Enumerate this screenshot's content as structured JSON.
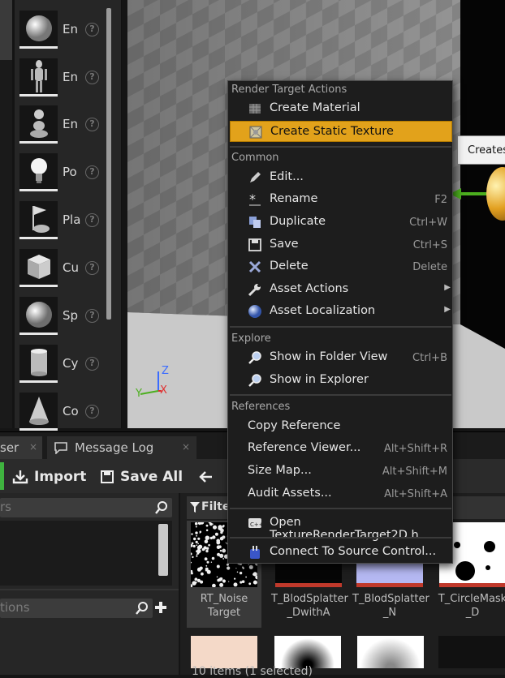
{
  "place_panel": {
    "items": [
      {
        "label": "En",
        "icon": "sphere-actor-icon"
      },
      {
        "label": "En",
        "icon": "mannequin-icon"
      },
      {
        "label": "En",
        "icon": "pawn-icon"
      },
      {
        "label": "Po",
        "icon": "point-light-icon"
      },
      {
        "label": "Pla",
        "icon": "player-start-icon"
      },
      {
        "label": "Cu",
        "icon": "cube-icon"
      },
      {
        "label": "Sp",
        "icon": "sphere-icon"
      },
      {
        "label": "Cy",
        "icon": "cylinder-icon"
      },
      {
        "label": "Co",
        "icon": "cone-icon"
      }
    ],
    "help": "?"
  },
  "viewport": {
    "tooltip": "Creates",
    "axis": {
      "z": "Z",
      "y": "Y",
      "x": "X"
    }
  },
  "context_menu": {
    "sections": {
      "render_target": "Render Target Actions",
      "common": "Common",
      "explore": "Explore",
      "references": "References"
    },
    "render_target_items": [
      {
        "label": "Create Material",
        "icon": "material-icon",
        "shortcut": ""
      },
      {
        "label": "Create Static Texture",
        "icon": "texture-icon",
        "shortcut": ""
      }
    ],
    "common_items": [
      {
        "label": "Edit...",
        "icon": "edit-icon",
        "shortcut": ""
      },
      {
        "label": "Rename",
        "icon": "rename-icon",
        "shortcut": "F2"
      },
      {
        "label": "Duplicate",
        "icon": "duplicate-icon",
        "shortcut": "Ctrl+W"
      },
      {
        "label": "Save",
        "icon": "save-icon",
        "shortcut": "Ctrl+S"
      },
      {
        "label": "Delete",
        "icon": "delete-icon",
        "shortcut": "Delete"
      },
      {
        "label": "Asset Actions",
        "icon": "wrench-icon",
        "shortcut": ""
      },
      {
        "label": "Asset Localization",
        "icon": "globe-icon",
        "shortcut": ""
      }
    ],
    "explore_items": [
      {
        "label": "Show in Folder View",
        "icon": "folder-search-icon",
        "shortcut": "Ctrl+B"
      },
      {
        "label": "Show in Explorer",
        "icon": "explorer-search-icon",
        "shortcut": ""
      }
    ],
    "reference_items": [
      {
        "label": "Copy Reference",
        "shortcut": ""
      },
      {
        "label": "Reference Viewer...",
        "shortcut": "Alt+Shift+R"
      },
      {
        "label": "Size Map...",
        "shortcut": "Alt+Shift+M"
      },
      {
        "label": "Audit Assets...",
        "shortcut": "Alt+Shift+A"
      }
    ],
    "open_item": {
      "label": "Open TextureRenderTarget2D.h",
      "icon": "cpp-icon"
    },
    "source_control_item": {
      "label": "Connect To Source Control...",
      "icon": "source-control-icon"
    },
    "highlight_color": "#e2a21b"
  },
  "content_browser": {
    "tabs": [
      {
        "label": "ser",
        "close": "×"
      },
      {
        "label": "Message Log",
        "close": "×"
      }
    ],
    "toolbar": {
      "import": "Import",
      "save_all": "Save All"
    },
    "search_placeholder_1": "rs",
    "search_placeholder_2": "tions",
    "filter_label": "Filte",
    "assets": [
      {
        "name": "RT_Noise Target",
        "selected": true
      },
      {
        "name": "T_BlodSplatter _DwithA",
        "selected": false
      },
      {
        "name": "T_BlodSplatter _N",
        "selected": false
      },
      {
        "name": "T_CircleMask _D",
        "selected": false
      }
    ],
    "status": "10 items (1 selected)"
  }
}
